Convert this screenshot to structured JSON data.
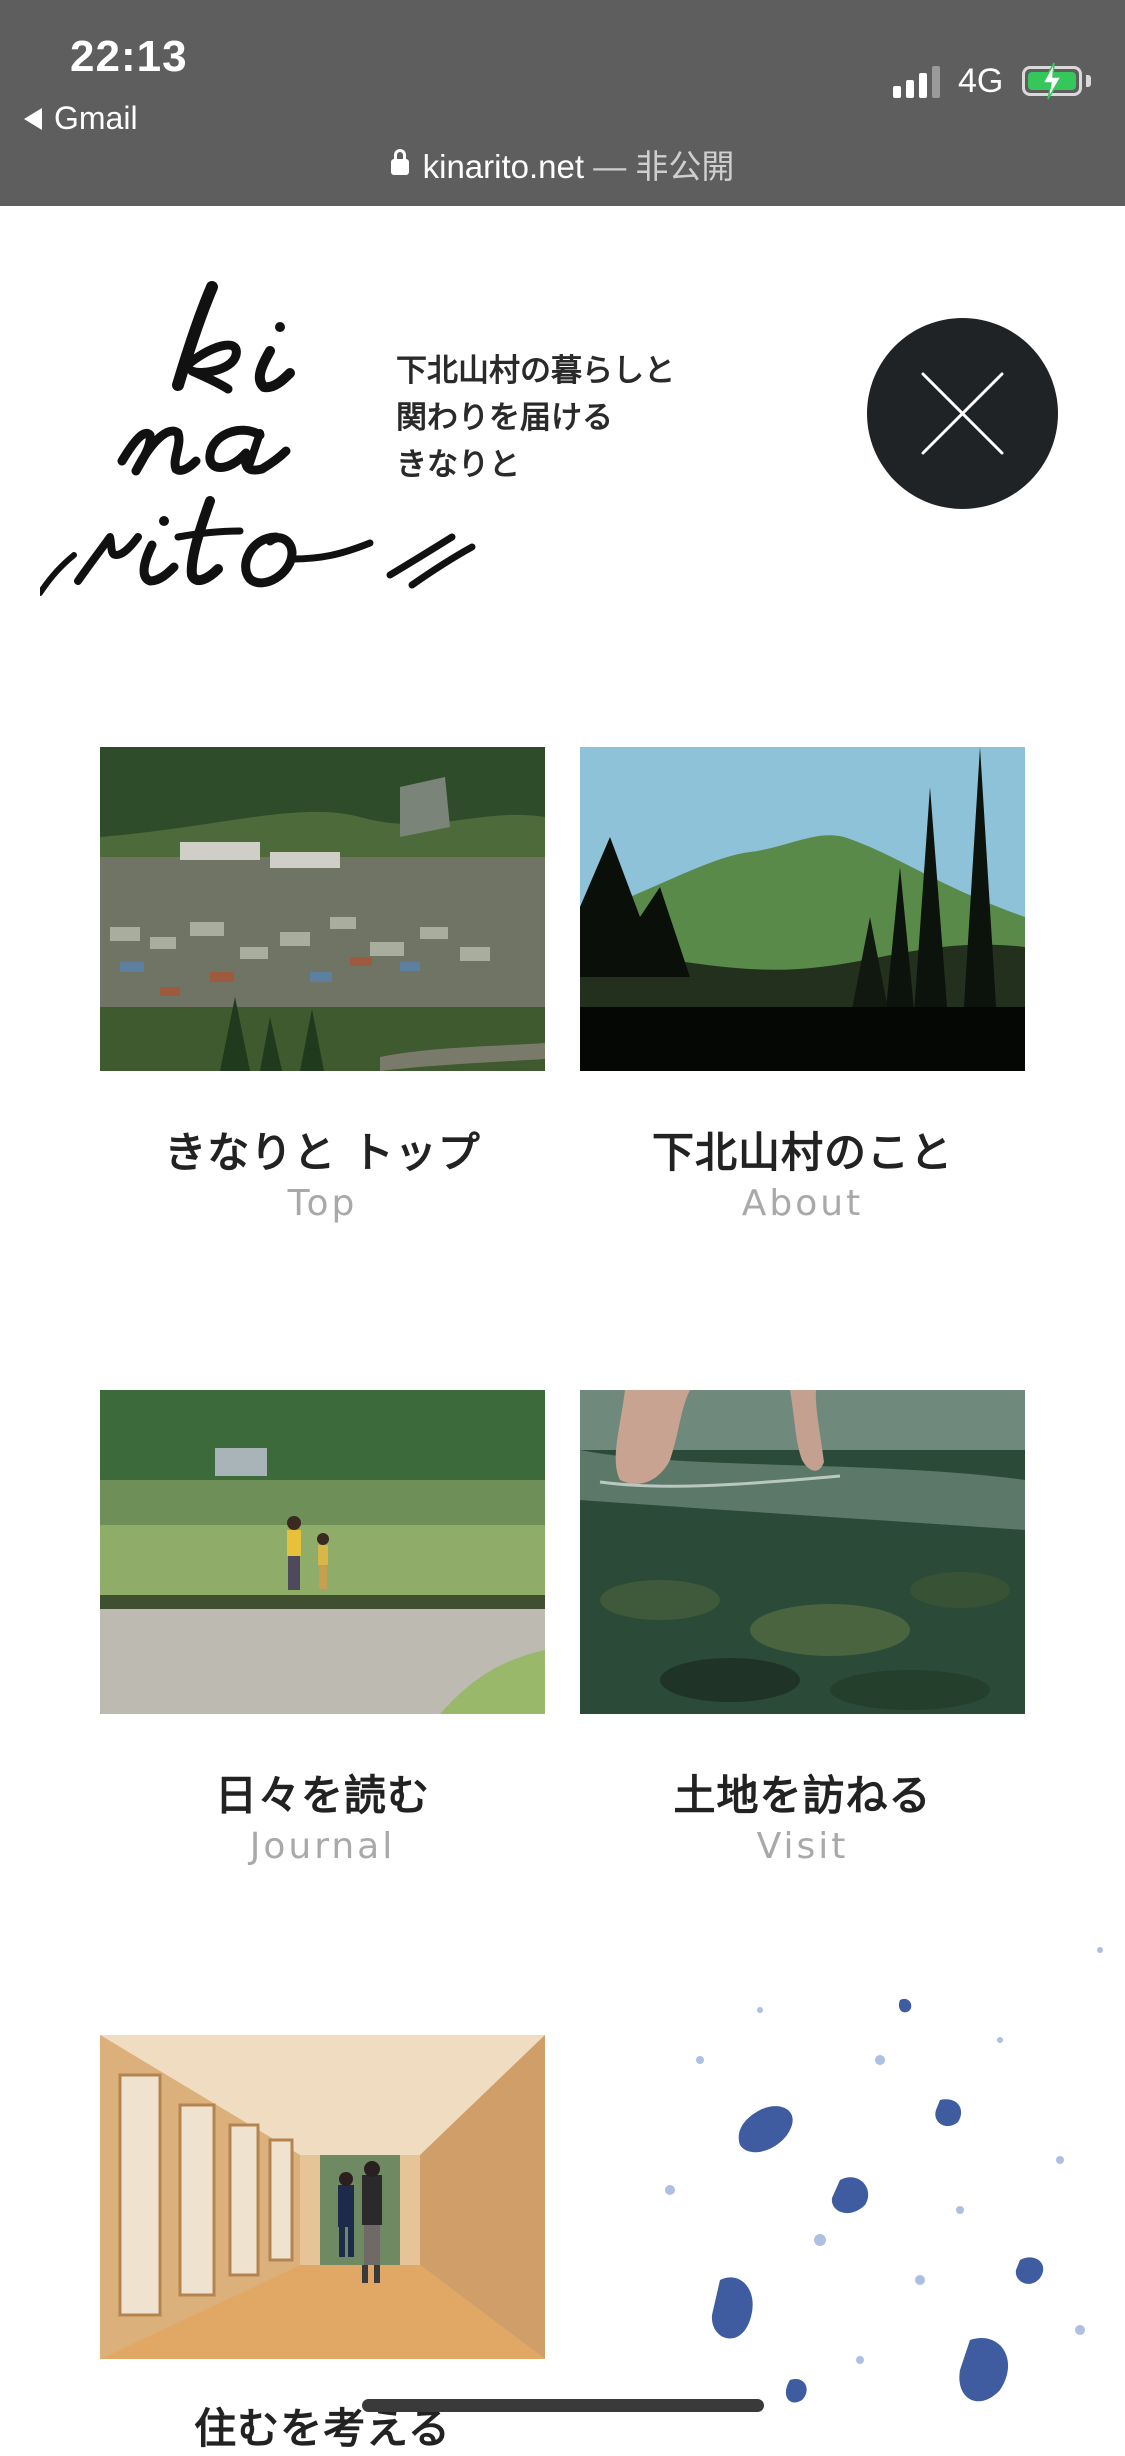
{
  "status": {
    "time": "22:13",
    "back_app": "Gmail",
    "network": "4G",
    "url": "kinarito.net",
    "url_suffix": " — 非公開"
  },
  "header": {
    "logo_text": "kinarito",
    "tagline_lines": [
      "下北山村の暮らしと",
      "関わりを届ける",
      "きなりと"
    ]
  },
  "menu": {
    "items": [
      {
        "jp": "きなりと トップ",
        "en": "Top"
      },
      {
        "jp": "下北山村のこと",
        "en": "About"
      },
      {
        "jp": "日々を読む",
        "en": "Journal"
      },
      {
        "jp": "土地を訪ねる",
        "en": "Visit"
      },
      {
        "jp": "住むを考える",
        "en": ""
      }
    ]
  },
  "colors": {
    "status_bar": "#5e5e5e",
    "close_button": "#1f2326",
    "label_en": "#a9a9a9",
    "splash_ink": "#1f3f8f"
  },
  "icons": [
    "lock-icon",
    "signal-icon",
    "battery-icon",
    "close-icon"
  ]
}
